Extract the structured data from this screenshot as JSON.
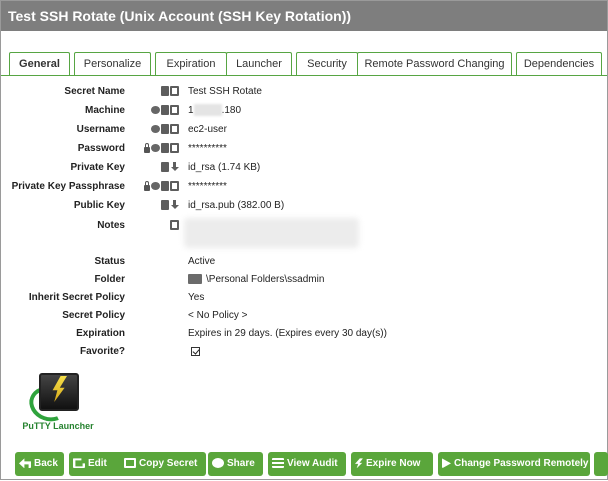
{
  "window": {
    "title": "Test SSH Rotate (Unix Account (SSH Key Rotation))"
  },
  "tabs": [
    "General",
    "Personalize",
    "Expiration",
    "Launcher",
    "Security",
    "Remote Password Changing",
    "Dependencies"
  ],
  "active_tab": "General",
  "fields": {
    "secret_name": {
      "label": "Secret Name",
      "value": "Test SSH Rotate"
    },
    "machine": {
      "label": "Machine",
      "value_prefix": "1",
      "value_suffix": ".180"
    },
    "username": {
      "label": "Username",
      "value": "ec2-user"
    },
    "password": {
      "label": "Password",
      "value": "**********"
    },
    "private_key": {
      "label": "Private Key",
      "value": "id_rsa (1.74 KB)"
    },
    "private_key_passphrase": {
      "label": "Private Key Passphrase",
      "value": "**********"
    },
    "public_key": {
      "label": "Public Key",
      "value": "id_rsa.pub (382.00 B)"
    },
    "notes": {
      "label": "Notes"
    },
    "status": {
      "label": "Status",
      "value": "Active"
    },
    "folder": {
      "label": "Folder",
      "value": "\\Personal Folders\\ssadmin"
    },
    "inherit_secret_policy": {
      "label": "Inherit Secret Policy",
      "value": "Yes"
    },
    "secret_policy": {
      "label": "Secret Policy",
      "value": "< No Policy >"
    },
    "expiration": {
      "label": "Expiration",
      "value": "Expires in 29 days. (Expires every 30 day(s))"
    },
    "favorite": {
      "label": "Favorite?",
      "checked": true
    }
  },
  "launcher": {
    "label": "PuTTY Launcher"
  },
  "toolbar": {
    "back": "Back",
    "edit": "Edit",
    "copy_secret": "Copy Secret",
    "share": "Share",
    "view_audit": "View Audit",
    "expire_now": "Expire Now",
    "change_password_remotely": "Change Password Remotely"
  },
  "colors": {
    "accent": "#5aa63b",
    "titlebar": "#7e7e7e",
    "launcher_text": "#278330"
  }
}
